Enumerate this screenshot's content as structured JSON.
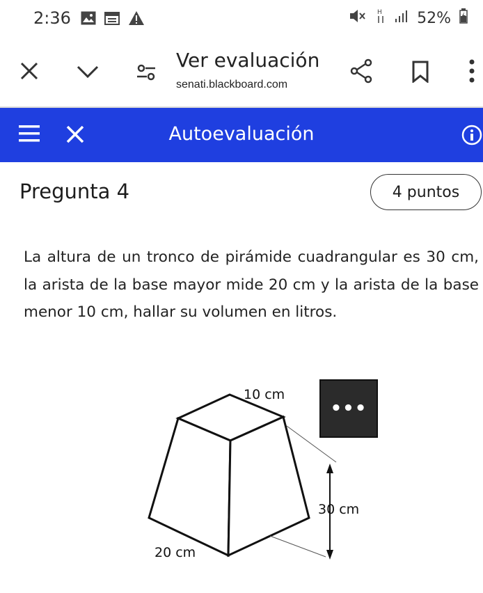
{
  "status_bar": {
    "time": "2:36",
    "battery": "52%"
  },
  "browser": {
    "title": "Ver evaluación",
    "url": "senati.blackboard.com"
  },
  "header": {
    "title": "Autoevaluación",
    "color": "#1f3fe0"
  },
  "question": {
    "title": "Pregunta 4",
    "points": "4 puntos",
    "text": "La altura de un tronco de pirámide cuadrangular es 30 cm, la arista de la base mayor mide 20 cm y la arista de la base menor 10 cm, hallar su volumen en litros."
  },
  "figure": {
    "top_edge_label": "10 cm",
    "height_label": "30 cm",
    "bottom_edge_label": "20 cm"
  },
  "more_button": {
    "label": "•••"
  }
}
